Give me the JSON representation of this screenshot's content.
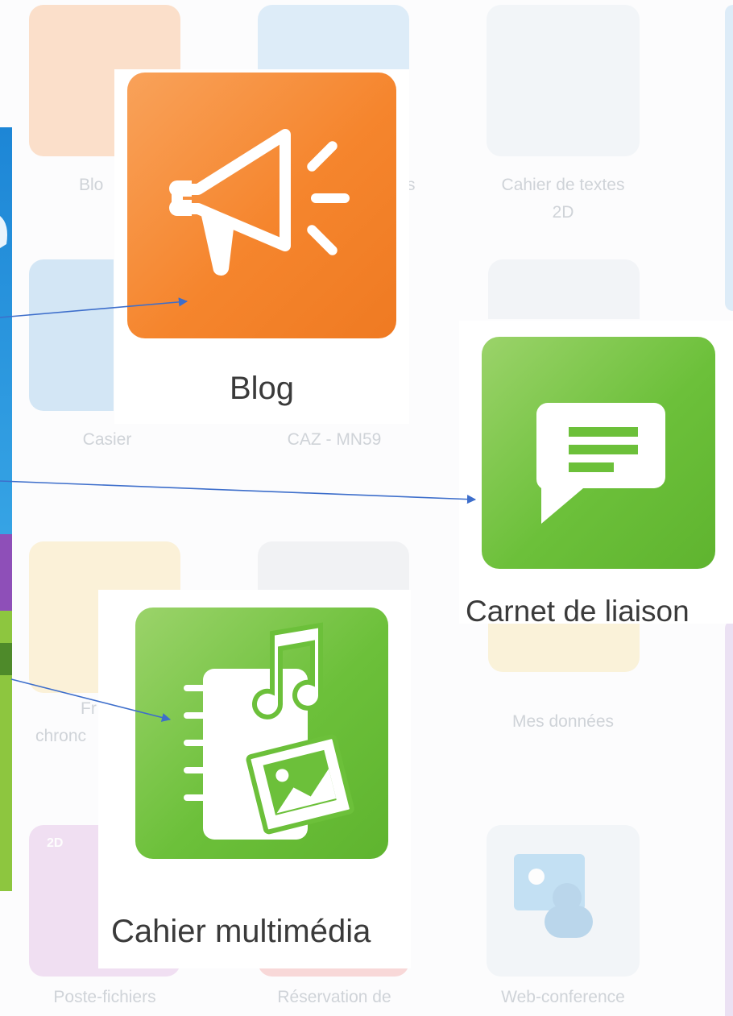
{
  "background_apps": {
    "blog_partial": "Blo",
    "cahier_partial_s": "s",
    "cahier_textes_2d": [
      "Cahier de textes",
      "2D"
    ],
    "casier": "Casier",
    "caz_mn59": "CAZ - MN59",
    "frise_partial_line1": "Fr",
    "frise_partial_line2": "chronc",
    "mes_donnees": "Mes données",
    "poste_fichiers": "Poste-fichiers",
    "reservation": "Réservation de",
    "web_conference": "Web-conference",
    "badge_2d": "2D"
  },
  "highlights": {
    "blog": {
      "label": "Blog",
      "color": "#f5852d"
    },
    "carnet": {
      "label": "Carnet de liaison",
      "color": "#6cc03a"
    },
    "multimedia": {
      "label": "Cahier multimédia",
      "color": "#6cc03a"
    }
  },
  "colors": {
    "arrow": "#3d6ecb",
    "left_panel_top": "#1f8fdc",
    "left_panel_bottom": "#8dc63f"
  }
}
